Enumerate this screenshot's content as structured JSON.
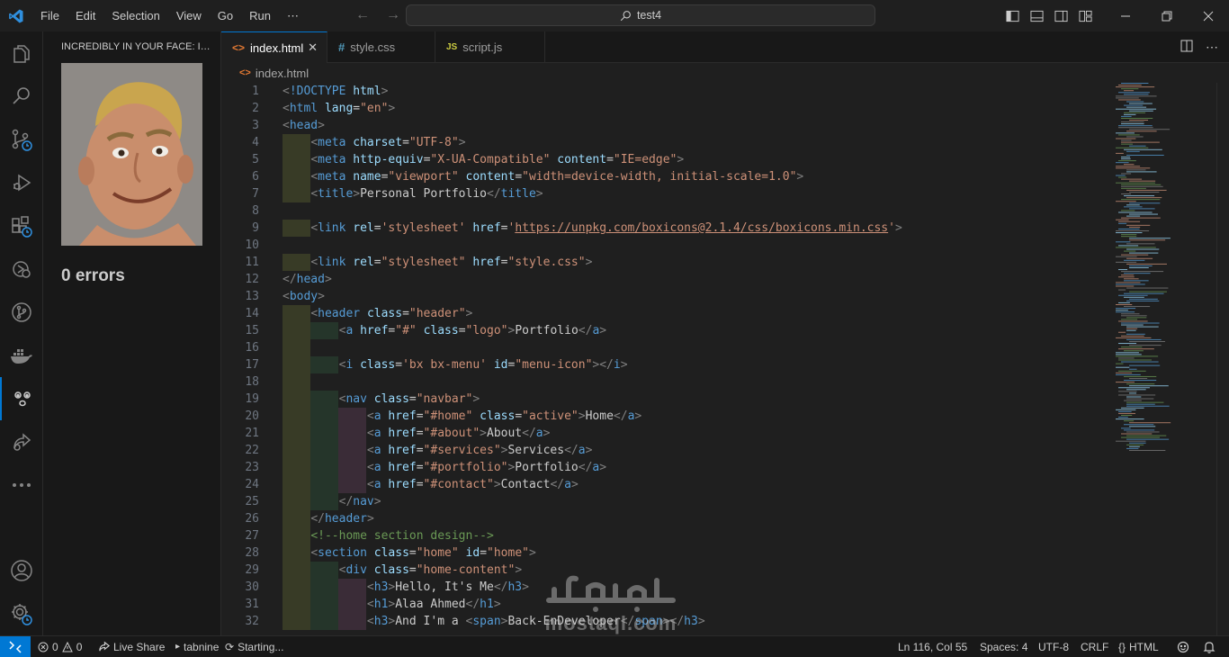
{
  "titlebar": {
    "menu": [
      "File",
      "Edit",
      "Selection",
      "View",
      "Go",
      "Run",
      "⋯"
    ],
    "search": "test4"
  },
  "sidebar": {
    "title": "INCREDIBLY IN YOUR FACE: IN Y...",
    "errors": "0 errors"
  },
  "tabs": [
    {
      "label": "index.html",
      "icon": "<>",
      "active": true
    },
    {
      "label": "style.css",
      "icon": "#",
      "active": false
    },
    {
      "label": "script.js",
      "icon": "JS",
      "active": false
    }
  ],
  "breadcrumb": {
    "icon": "<>",
    "file": "index.html"
  },
  "code": {
    "line_numbers": [
      "1",
      "2",
      "3",
      "4",
      "5",
      "6",
      "7",
      "8",
      "9",
      "10",
      "11",
      "12",
      "13",
      "14",
      "15",
      "16",
      "17",
      "18",
      "19",
      "20",
      "21",
      "22",
      "23",
      "24",
      "25",
      "26",
      "27",
      "28",
      "29",
      "30",
      "31",
      "32"
    ]
  },
  "watermark": "mostaql.com",
  "statusbar": {
    "problems_errors": "0",
    "problems_warnings": "0",
    "live_share": "Live Share",
    "tabnine": "tabnine",
    "starting": "Starting...",
    "position": "Ln 116, Col 55",
    "spaces": "Spaces: 4",
    "encoding": "UTF-8",
    "eol": "CRLF",
    "language": "HTML"
  },
  "colors": {
    "accent": "#0078d4",
    "tag": "#569cd6",
    "attribute": "#9cdcfe",
    "string": "#ce9178",
    "comment": "#6a9955"
  }
}
